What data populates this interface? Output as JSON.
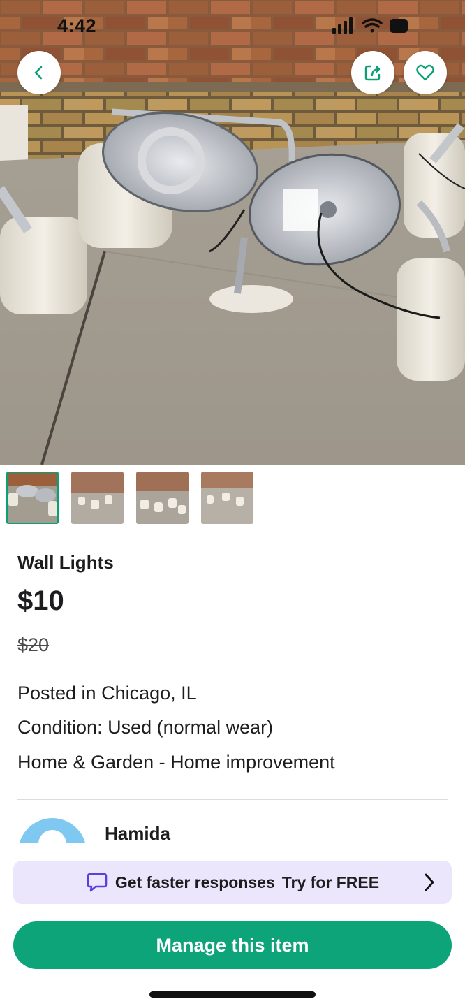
{
  "status_bar": {
    "time": "4:42"
  },
  "nav": {
    "back_icon": "chevron-left-icon",
    "share_icon": "share-icon",
    "favorite_icon": "heart-icon"
  },
  "thumbnails": [
    {
      "name": "photo-1",
      "selected": true
    },
    {
      "name": "photo-2",
      "selected": false
    },
    {
      "name": "photo-3",
      "selected": false
    },
    {
      "name": "photo-4",
      "selected": false
    }
  ],
  "listing": {
    "title": "Wall Lights",
    "price": "$10",
    "original_price": "$20",
    "location": "Posted in Chicago, IL",
    "condition": "Condition: Used (normal wear)",
    "category": "Home & Garden - Home improvement"
  },
  "seller": {
    "name": "Hamida"
  },
  "promo": {
    "label": "Get faster responses",
    "cta": "Try for FREE",
    "icon": "chat-bubble-icon"
  },
  "actions": {
    "manage_label": "Manage this item"
  },
  "colors": {
    "accent": "#0da47a",
    "promo_bg": "#ebe6fb",
    "promo_icon": "#5b3fd9"
  }
}
